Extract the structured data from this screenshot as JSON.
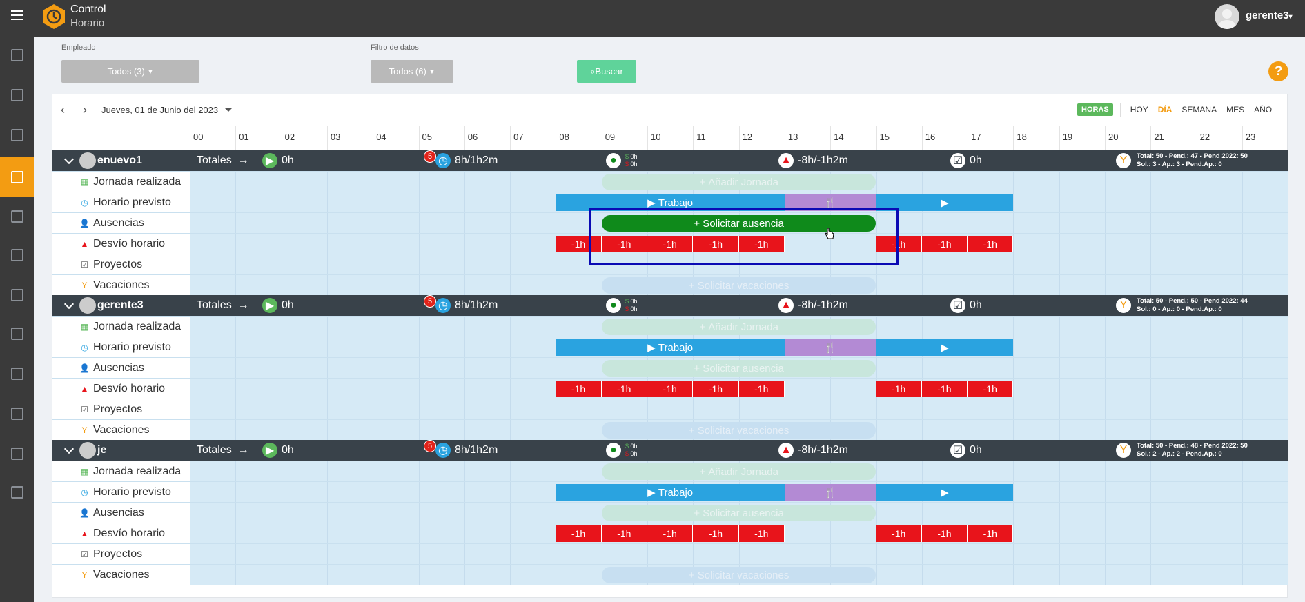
{
  "app": {
    "brand_line1": "Control",
    "brand_line2": "Horario",
    "user": "gerente3"
  },
  "sidebar": {
    "items": [
      "dashboard-icon",
      "user-icon",
      "clipboard-icon",
      "calendar-icon",
      "search-icon",
      "report-icon",
      "folder-icon",
      "building-icon",
      "help-icon",
      "settings-icon",
      "fingerprint-icon",
      "map-icon"
    ],
    "active": "calendar-icon"
  },
  "filters": {
    "employee_label": "Empleado",
    "employee_value": "Todos (3)",
    "data_label": "Filtro de datos",
    "data_value": "Todos (6)",
    "search_label": "Buscar",
    "help_label": "?"
  },
  "calendar": {
    "date": "Jueves, 01 de Junio del 2023",
    "views": {
      "hours": "HORAS",
      "today": "HOY",
      "day": "DÍA",
      "week": "SEMANA",
      "month": "MES",
      "year": "AÑO"
    },
    "hours": [
      "00",
      "01",
      "02",
      "03",
      "04",
      "05",
      "06",
      "07",
      "08",
      "09",
      "10",
      "11",
      "12",
      "13",
      "14",
      "15",
      "16",
      "17",
      "18",
      "19",
      "20",
      "21",
      "22",
      "23"
    ],
    "row_labels": [
      "Jornada realizada",
      "Horario previsto",
      "Ausencias",
      "Desvío horario",
      "Proyectos",
      "Vacaciones"
    ],
    "totals_label": "Totales",
    "work_label": "Trabajo",
    "add_day_label": "Añadir Jornada",
    "request_absence_label": "Solicitar ausencia",
    "request_vacation_label": "Solicitar vacaciones",
    "deviation_value": "-1h",
    "employees": [
      {
        "name": "enuevo1",
        "worked": "0h",
        "badge": "5",
        "planned": "8h/1h2m",
        "absence_a": "0h",
        "absence_b": "0h",
        "deviation": "-8h/-1h2m",
        "projects": "0h",
        "summary1": "Total: 50 - Pend.: 47 - Pend 2022: 50",
        "summary2": "Sol.: 3 - Ap.: 3 - Pend.Ap.: 0",
        "active_absence": true
      },
      {
        "name": "gerente3",
        "worked": "0h",
        "badge": "5",
        "planned": "8h/1h2m",
        "absence_a": "0h",
        "absence_b": "0h",
        "deviation": "-8h/-1h2m",
        "projects": "0h",
        "summary1": "Total: 50 - Pend.: 50 - Pend 2022: 44",
        "summary2": "Sol.: 0 - Ap.: 0 - Pend.Ap.: 0",
        "active_absence": false
      },
      {
        "name": "je",
        "worked": "0h",
        "badge": "5",
        "planned": "8h/1h2m",
        "absence_a": "0h",
        "absence_b": "0h",
        "deviation": "-8h/-1h2m",
        "projects": "0h",
        "summary1": "Total: 50 - Pend.: 48 - Pend 2022: 50",
        "summary2": "Sol.: 2 - Ap.: 2 - Pend.Ap.: 0",
        "active_absence": false
      }
    ]
  },
  "colors": {
    "accent": "#f39c12",
    "work": "#2aa3e0",
    "lunch": "#b38ad4",
    "deviation": "#e8141b",
    "absence": "#0f8a1b",
    "header": "#39424a"
  }
}
